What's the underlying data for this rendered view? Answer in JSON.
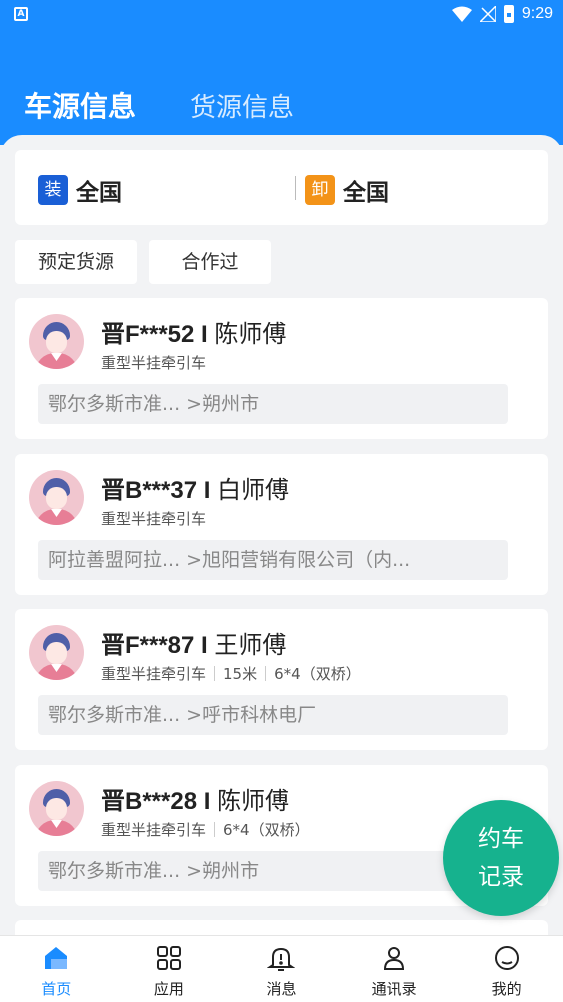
{
  "status_bar": {
    "time": "9:29"
  },
  "header": {
    "tabs": [
      {
        "label": "车源信息",
        "active": true
      },
      {
        "label": "货源信息",
        "active": false
      }
    ]
  },
  "location": {
    "load_badge": "装",
    "load_text": "全国",
    "unload_badge": "卸",
    "unload_text": "全国"
  },
  "filters": [
    "预定货源",
    "合作过"
  ],
  "vehicles": [
    {
      "plate": "晋F***52",
      "sep": "I",
      "driver": "陈师傅",
      "tags": [
        "重型半挂牵引车"
      ],
      "route": "鄂尔多斯市准... >朔州市"
    },
    {
      "plate": "晋B***37",
      "sep": "I",
      "driver": "白师傅",
      "tags": [
        "重型半挂牵引车"
      ],
      "route": "阿拉善盟阿拉... >旭阳营销有限公司（内..."
    },
    {
      "plate": "晋F***87",
      "sep": "I",
      "driver": "王师傅",
      "tags": [
        "重型半挂牵引车",
        "15米",
        "6*4（双桥）"
      ],
      "route": "鄂尔多斯市准... >呼市科林电厂"
    },
    {
      "plate": "晋B***28",
      "sep": "I",
      "driver": "陈师傅",
      "tags": [
        "重型半挂牵引车",
        "6*4（双桥）"
      ],
      "route": "鄂尔多斯市准... >朔州市"
    }
  ],
  "fab": {
    "line1": "约车",
    "line2": "记录"
  },
  "bottom_nav": [
    {
      "label": "首页",
      "icon": "home-icon",
      "active": true
    },
    {
      "label": "应用",
      "icon": "apps-icon",
      "active": false
    },
    {
      "label": "消息",
      "icon": "bell-icon",
      "active": false
    },
    {
      "label": "通讯录",
      "icon": "contacts-icon",
      "active": false
    },
    {
      "label": "我的",
      "icon": "profile-icon",
      "active": false
    }
  ],
  "colors": {
    "primary": "#1a8cff",
    "load": "#1a5fd6",
    "unload": "#f39318",
    "fab": "#16b28e"
  }
}
